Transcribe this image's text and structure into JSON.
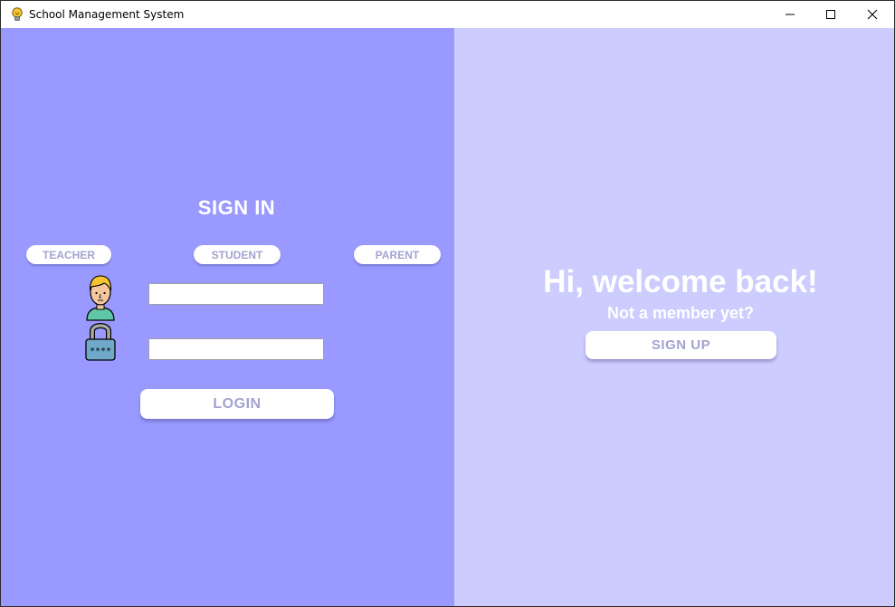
{
  "window": {
    "title": "School Management System",
    "icons": {
      "app": "lightbulb-app-icon",
      "minimize": "minimize-icon",
      "maximize": "maximize-icon",
      "close": "close-icon"
    }
  },
  "signin": {
    "title": "SIGN IN",
    "roles": [
      "TEACHER",
      "STUDENT",
      "PARENT"
    ],
    "username": {
      "value": "",
      "placeholder": "",
      "icon": "user-avatar-icon"
    },
    "password": {
      "value": "",
      "placeholder": "",
      "icon": "padlock-icon"
    },
    "login_label": "LOGIN"
  },
  "welcome": {
    "title": "Hi, welcome back!",
    "subtitle": "Not a member yet?",
    "signup_label": "SIGN UP"
  },
  "colors": {
    "left_panel": "#9999ff",
    "right_panel": "#ccccff",
    "button_text": "#a3a3d2",
    "text": "#ffffff"
  }
}
